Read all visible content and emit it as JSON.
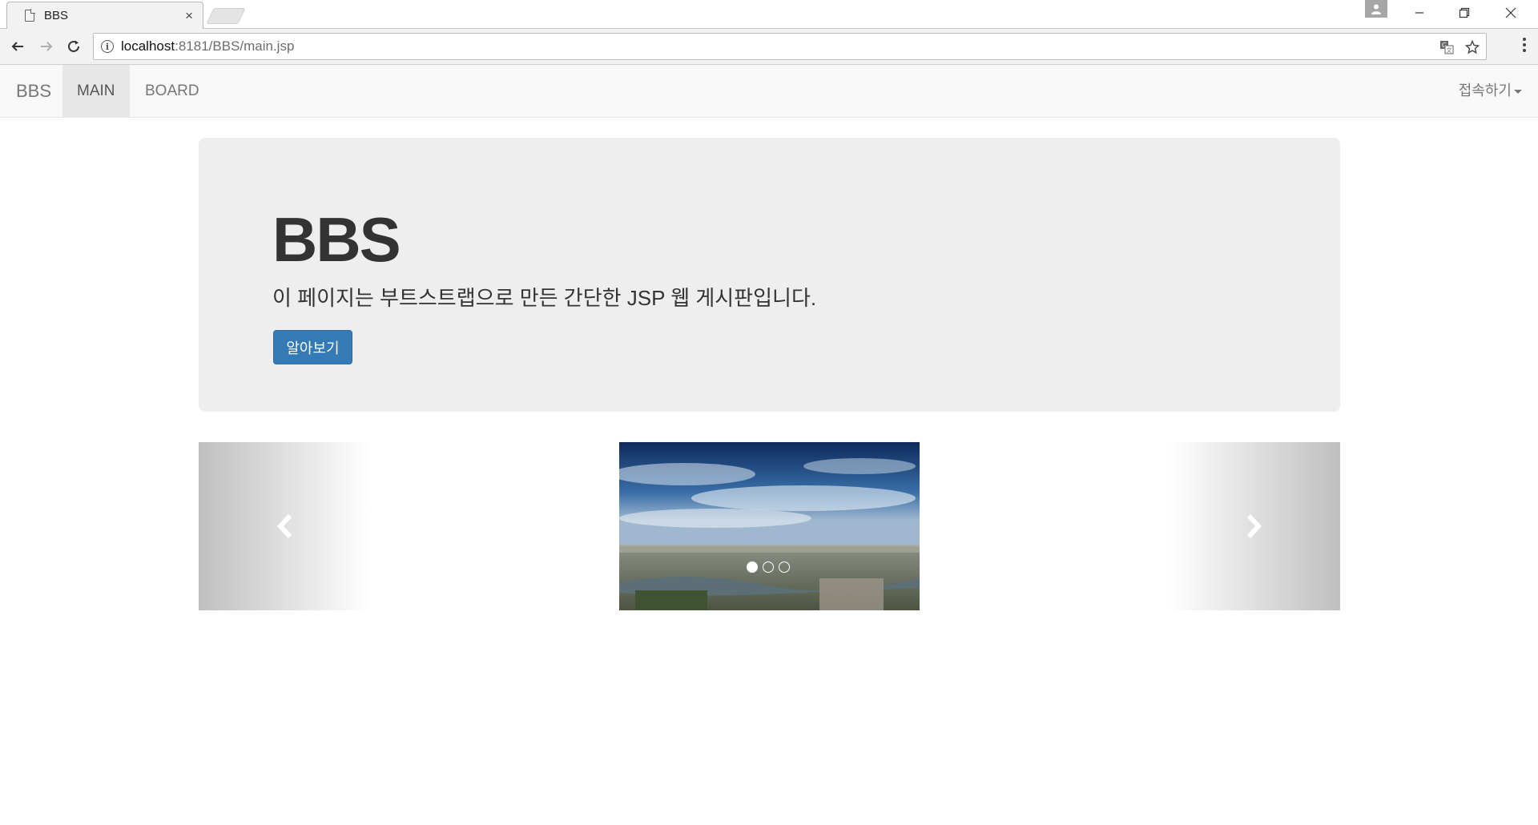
{
  "browser": {
    "tab_title": "BBS",
    "tab_close": "×",
    "url_host": "localhost",
    "url_rest": ":8181/BBS/main.jsp"
  },
  "navbar": {
    "brand": "BBS",
    "items": [
      {
        "label": "MAIN",
        "active": true
      },
      {
        "label": "BOARD",
        "active": false
      }
    ],
    "right_menu": "접속하기"
  },
  "jumbotron": {
    "title": "BBS",
    "text": "이 페이지는 부트스트랩으로 만든 간단한 JSP 웹 게시판입니다.",
    "button": "알아보기",
    "button_color": "#337ab7"
  },
  "carousel": {
    "slide_count": 3,
    "active_index": 0
  }
}
